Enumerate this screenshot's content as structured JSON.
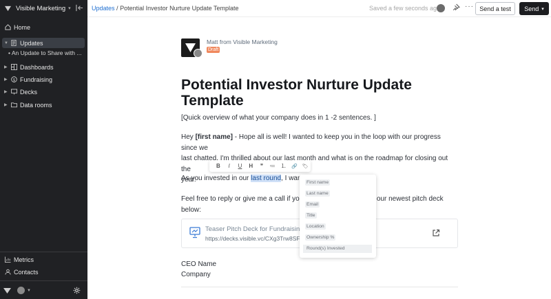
{
  "sidebar": {
    "org_name": "Visible Marketing",
    "items": [
      {
        "label": "Home",
        "icon": "home-icon"
      },
      {
        "label": "Updates",
        "icon": "document-icon",
        "active": true
      },
      {
        "label": "Dashboards",
        "icon": "dashboard-icon"
      },
      {
        "label": "Fundraising",
        "icon": "dollar-icon"
      },
      {
        "label": "Decks",
        "icon": "presentation-icon"
      },
      {
        "label": "Data rooms",
        "icon": "folder-icon"
      }
    ],
    "sub_item": "An Update to Share with ...",
    "bottom_items": [
      {
        "label": "Metrics",
        "icon": "chart-icon"
      },
      {
        "label": "Contacts",
        "icon": "contacts-icon"
      }
    ]
  },
  "topbar": {
    "breadcrumb_root": "Updates",
    "breadcrumb_sep": "/",
    "breadcrumb_current": "Potential Investor Nurture Update Template",
    "saved_status": "Saved a few seconds ago",
    "send_test_label": "Send a test",
    "send_label": "Send"
  },
  "doc": {
    "author": "Matt from Visible Marketing",
    "status": "Draft",
    "title": "Potential Investor Nurture Update Template",
    "overview": "[Quick overview of what your company does in 1 -2 sentences. ]",
    "para1_a": "Hey ",
    "para1_name": "[first name]",
    "para1_b": " - Hope all is well! I wanted to keep you in the loop with our progress since we",
    "para1_line2": "last chatted. I'm thrilled about our last month and what is on the roadmap for closing out the",
    "para1_line3": "year.",
    "para2_a": "As you invested in our ",
    "para2_hl": "last round",
    "para2_b": ", I wante",
    "para3_a": "Feel free to reply or give me a call if you h",
    "para3_b": "n find our newest pitch deck",
    "para3_line2": "below:",
    "signature_name": "CEO Name",
    "signature_company": "Company"
  },
  "link_card": {
    "title": "Teaser Pitch Deck for Fundraising",
    "url": "https://decks.visible.vc/CXg3Trw8SF"
  },
  "format_toolbar": [
    "B",
    "I",
    "U",
    "H",
    "❞",
    "≔",
    "⒈",
    "🔗",
    "🏷"
  ],
  "merge_tags": [
    "First name",
    "Last name",
    "Email",
    "Title",
    "Location",
    "Ownership %",
    "Round(s) Invested"
  ]
}
